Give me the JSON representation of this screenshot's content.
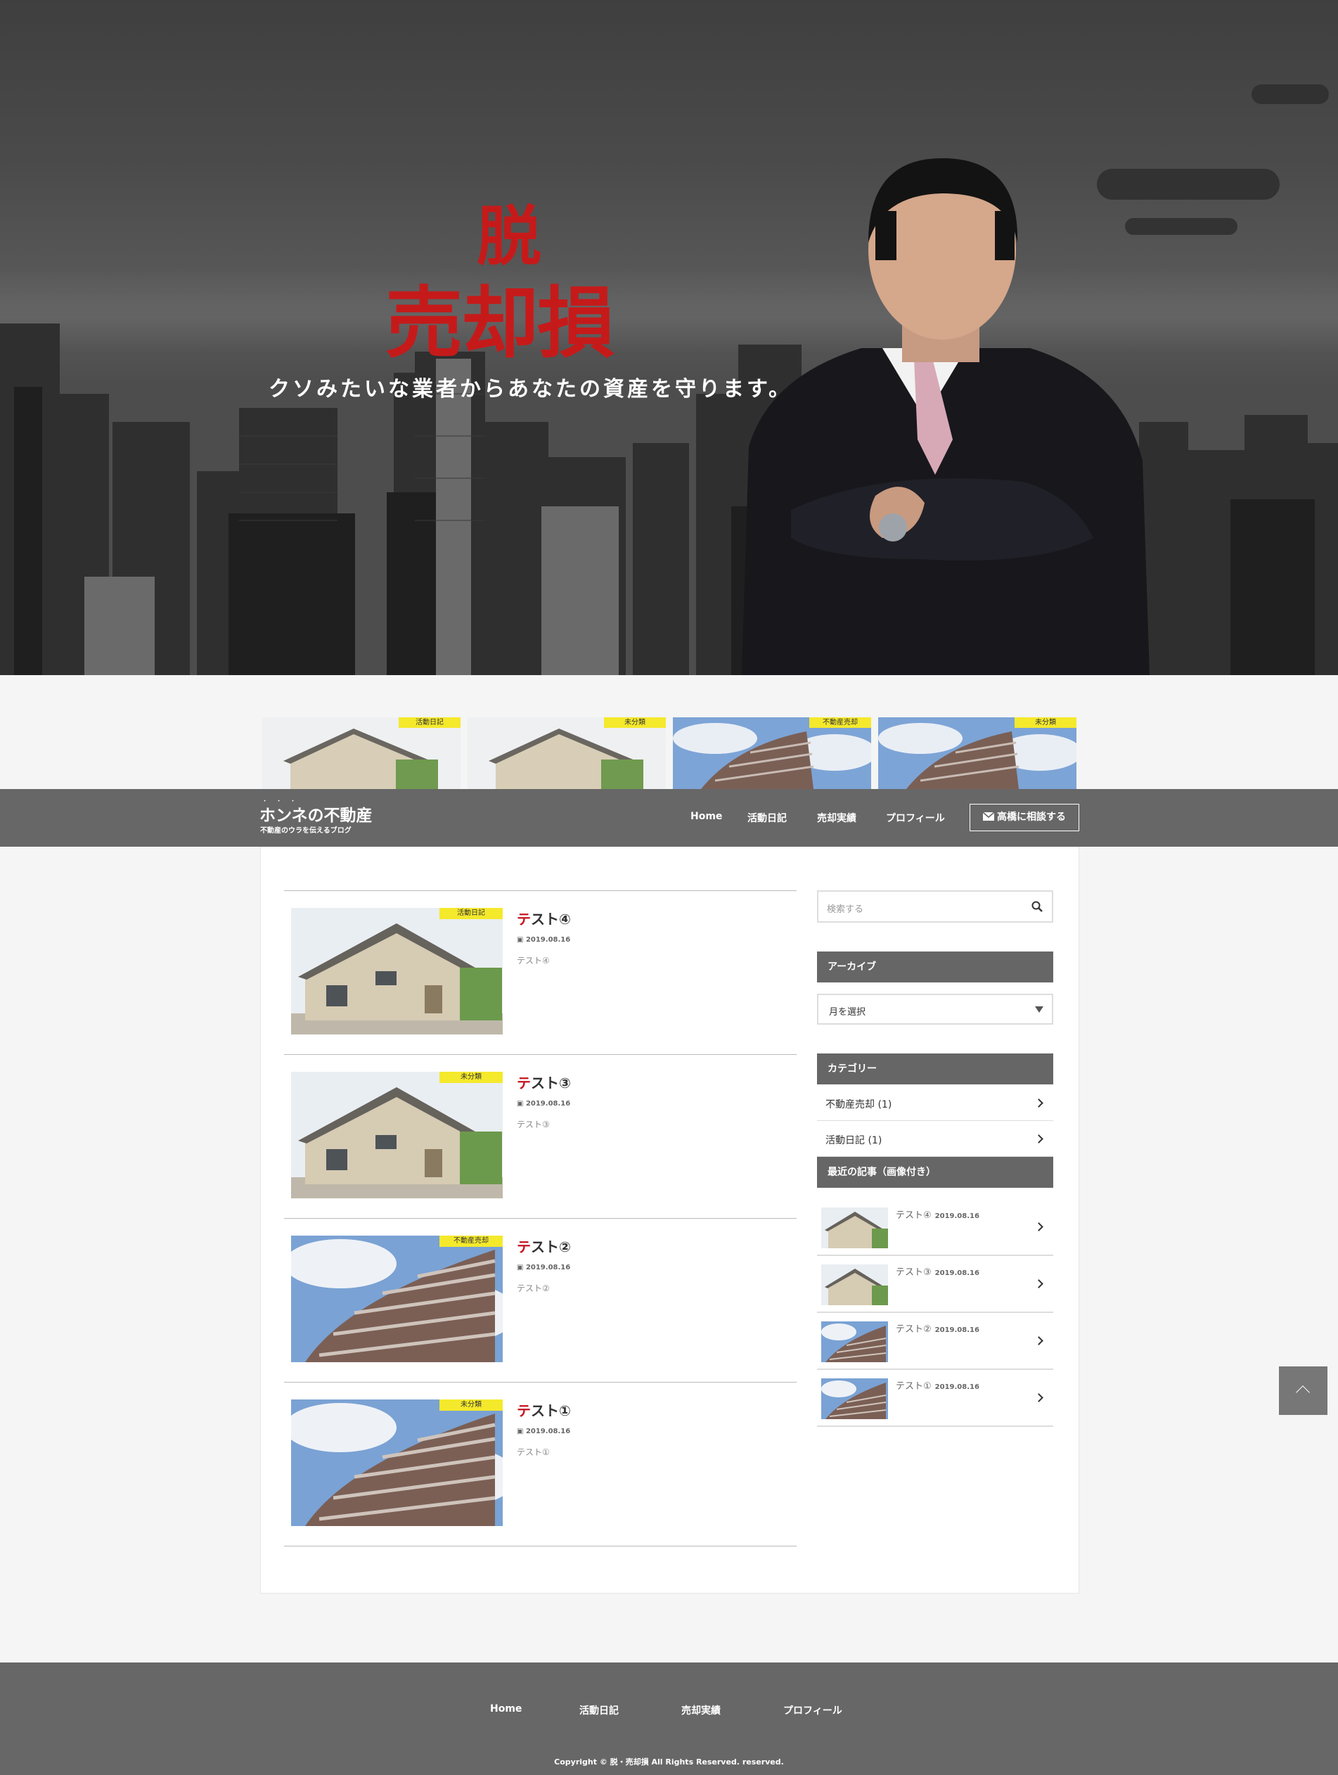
{
  "hero": {
    "heading_top": "脱",
    "heading_main": "売却損",
    "tagline": "クソみたいな業者からあなたの資産を守ります。"
  },
  "pickup": [
    {
      "tag": "活動日記",
      "image": "house"
    },
    {
      "tag": "未分類",
      "image": "house"
    },
    {
      "tag": "不動産売却",
      "image": "tower"
    },
    {
      "tag": "未分類",
      "image": "tower"
    }
  ],
  "header": {
    "site_title": "ホンネの不動産",
    "emphasis_dots": "・・・",
    "site_subtitle": "不動産のウラを伝えるブログ",
    "nav": [
      "Home",
      "活動日記",
      "売却実績",
      "プロフィール"
    ],
    "cta_label": "高橋に相談する",
    "cta_icon": "mail-icon"
  },
  "posts": [
    {
      "tag": "活動日記",
      "title_first": "テ",
      "title_rest": "スト④",
      "date": "2019.08.16",
      "excerpt": "テスト④",
      "image": "house"
    },
    {
      "tag": "未分類",
      "title_first": "テ",
      "title_rest": "スト③",
      "date": "2019.08.16",
      "excerpt": "テスト③",
      "image": "house"
    },
    {
      "tag": "不動産売却",
      "title_first": "テ",
      "title_rest": "スト②",
      "date": "2019.08.16",
      "excerpt": "テスト②",
      "image": "tower"
    },
    {
      "tag": "未分類",
      "title_first": "テ",
      "title_rest": "スト①",
      "date": "2019.08.16",
      "excerpt": "テスト①",
      "image": "tower"
    }
  ],
  "sidebar": {
    "search_placeholder": "検索する",
    "archive_heading": "アーカイブ",
    "archive_select": "月を選択",
    "category_heading": "カテゴリー",
    "categories": [
      "不動産売却 (1)",
      "活動日記 (1)"
    ],
    "recent_heading": "最近の記事（画像付き）",
    "recent": [
      {
        "title": "テスト④",
        "date": "2019.08.16",
        "image": "house"
      },
      {
        "title": "テスト③",
        "date": "2019.08.16",
        "image": "house"
      },
      {
        "title": "テスト②",
        "date": "2019.08.16",
        "image": "tower"
      },
      {
        "title": "テスト①",
        "date": "2019.08.16",
        "image": "tower"
      }
    ]
  },
  "footer": {
    "nav": [
      "Home",
      "活動日記",
      "売却実績",
      "プロフィール"
    ],
    "copyright": "Copyright © 脱・売却損 All Rights Reserved. reserved."
  },
  "colors": {
    "accent_red": "#c4141e",
    "tag_yellow": "#f5e92c",
    "bar_gray": "#676767"
  }
}
